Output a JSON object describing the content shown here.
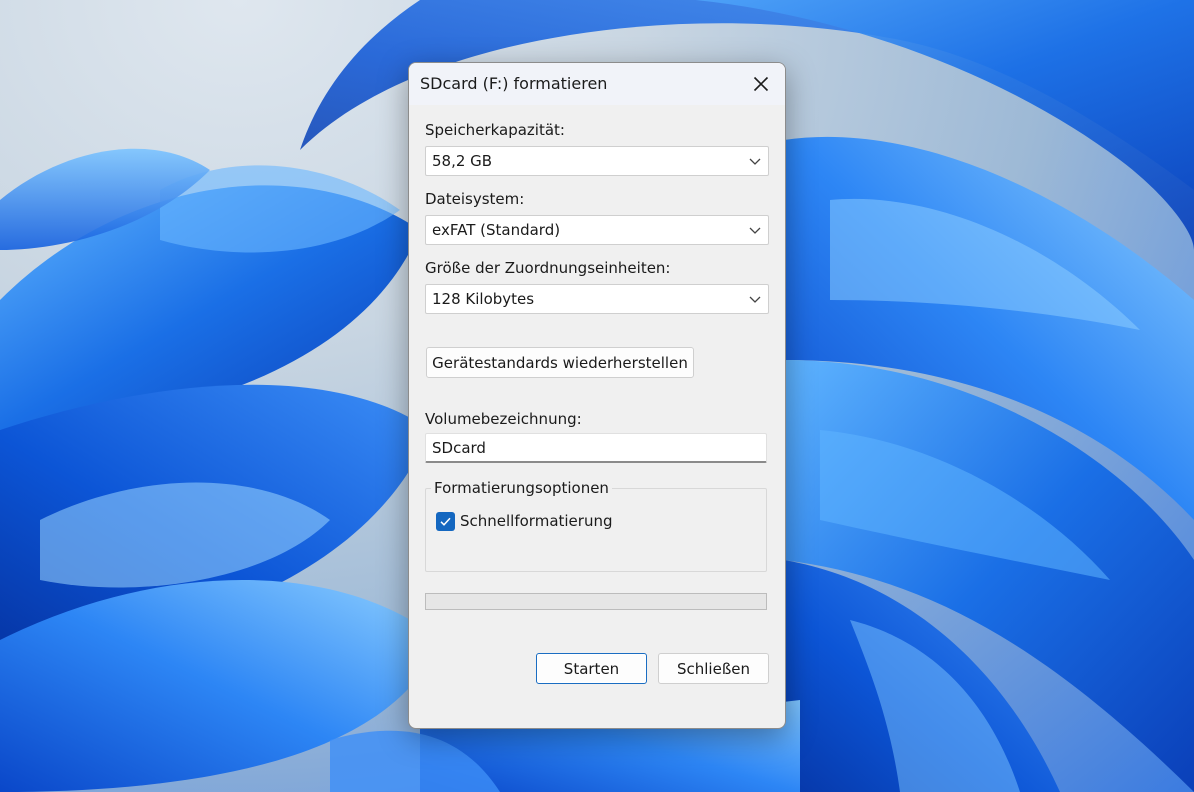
{
  "dialog": {
    "title": "SDcard (F:) formatieren",
    "capacity": {
      "label": "Speicherkapazität:",
      "value": "58,2 GB"
    },
    "filesystem": {
      "label": "Dateisystem:",
      "value": "exFAT (Standard)"
    },
    "allocation": {
      "label": "Größe der Zuordnungseinheiten:",
      "value": "128 Kilobytes"
    },
    "restore_defaults_label": "Gerätestandards wiederherstellen",
    "volume": {
      "label": "Volumebezeichnung:",
      "value": "SDcard"
    },
    "options": {
      "legend": "Formatierungsoptionen",
      "quick_format_label": "Schnellformatierung",
      "quick_format_checked": true
    },
    "progress": 0,
    "start_label": "Starten",
    "close_label": "Schließen"
  },
  "colors": {
    "accent": "#1467c0",
    "dialog_bg": "#f0f0f0",
    "wallpaper_blue": "#1a73e8"
  },
  "icons": {
    "close": "close-icon",
    "dropdown": "chevron-down-icon",
    "check": "checkmark-icon"
  }
}
